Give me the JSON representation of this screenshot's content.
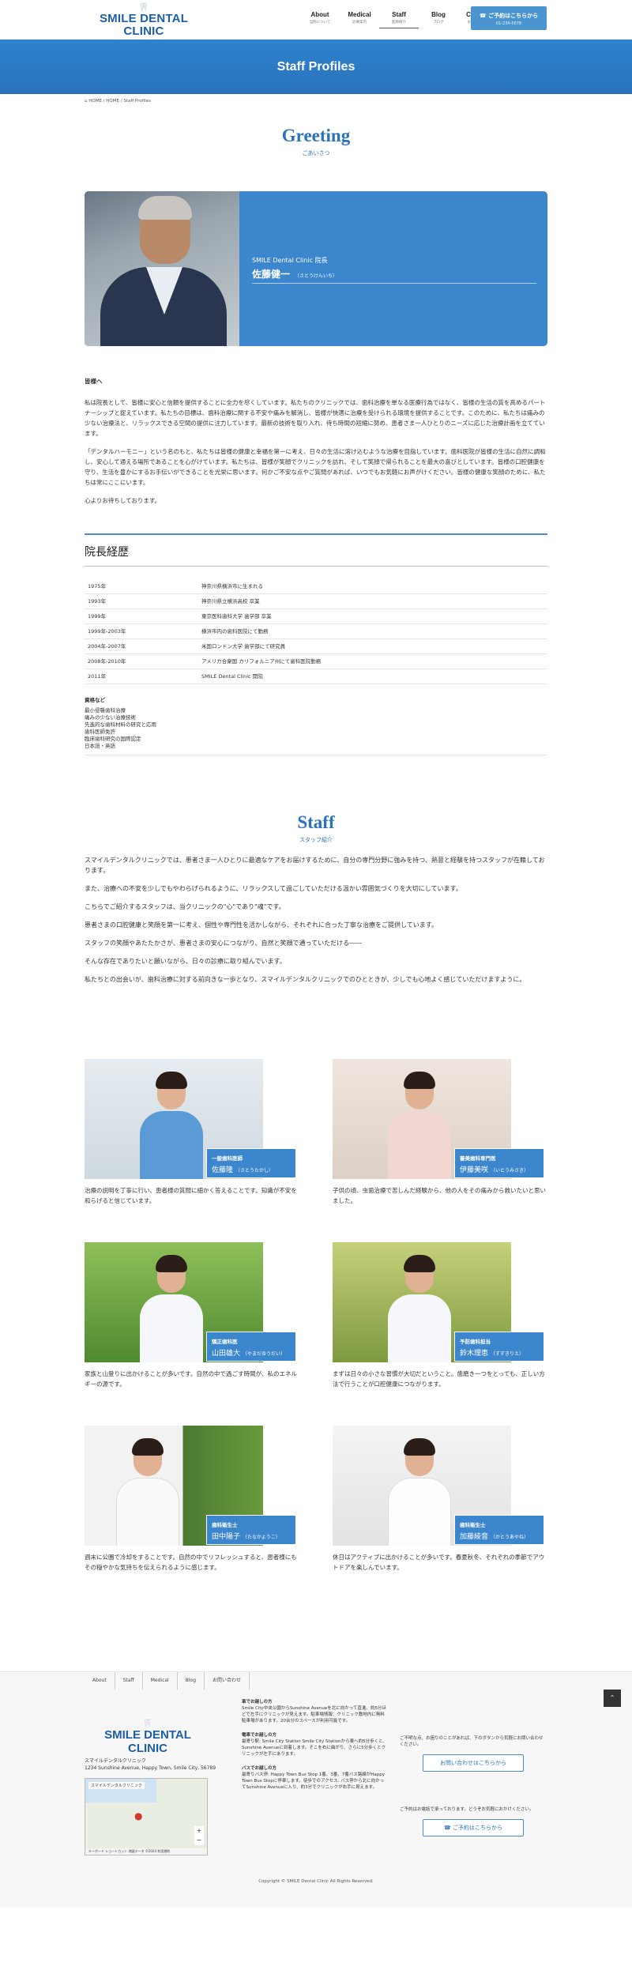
{
  "header": {
    "logo_text": "SMILE DENTAL CLINIC",
    "nav": [
      {
        "en": "About",
        "jp": "当院について"
      },
      {
        "en": "Medical",
        "jp": "診療案内"
      },
      {
        "en": "Staff",
        "jp": "医師紹介"
      },
      {
        "en": "Blog",
        "jp": "ブログ"
      },
      {
        "en": "Contact",
        "jp": "お問い合わせ"
      }
    ],
    "reserve_label": "ご予約はこちらから",
    "reserve_phone": "01-234-5678"
  },
  "banner_title": "Staff Profiles",
  "breadcrumb": "HOME  /  HOME  /  Staff Profiles",
  "greeting": {
    "title_en": "Greeting",
    "title_jp": "ごあいさつ",
    "director_role": "SMILE Dental Clinic 院長",
    "director_name": "佐藤健一",
    "director_kana": "（さとうけんいち）",
    "lead": "皆様へ",
    "paragraphs": [
      "私は院長として、皆様に安心と信頼を提供することに全力を尽くしています。私たちのクリニックでは、歯科治療を単なる医療行為ではなく、皆様の生活の質を高めるパートナーシップと捉えています。私たちの目標は、歯科治療に関する不安や痛みを解消し、皆様が快適に治療を受けられる環境を提供することです。このために、私たちは痛みの少ない治療法と、リラックスできる空間の提供に注力しています。最新の技術を取り入れ、待ち時間の短縮に努め、患者さま一人ひとりのニーズに応じた治療計画を立てています。",
      "「デンタルハーモニー」という名のもと、私たちは皆様の健康と幸福を第一に考え、日々の生活に溶け込むような治療を目指しています。歯科医院が皆様の生活に自然に調和し、安心して通える場所であることを心がけています。私たちは、皆様が笑顔でクリニックを訪れ、そして笑顔で帰られることを最大の喜びとしています。皆様の口腔健康を守り、生活を豊かにするお手伝いができることを光栄に思います。何かご不安な点やご質問があれば、いつでもお気軽にお声がけください。皆様の健康な笑顔のために、私たちは常にここにいます。",
      "心よりお待ちしております。"
    ]
  },
  "career": {
    "title": "院長経歴",
    "rows": [
      {
        "year": "1975年",
        "text": "神奈川県横浜市に生まれる"
      },
      {
        "year": "1993年",
        "text": "神奈川県立横浜高校 卒業"
      },
      {
        "year": "1999年",
        "text": "東京医科歯科大学 歯学部 卒業"
      },
      {
        "year": "1999年-2003年",
        "text": "横浜市内の歯科医院にて勤務"
      },
      {
        "year": "2004年-2007年",
        "text": "米国ロンドン大学 歯学部にて研究員"
      },
      {
        "year": "2008年-2010年",
        "text": "アメリカ合衆国 カリフォルニア州にて歯科医院勤務"
      },
      {
        "year": "2011年",
        "text": "SMILE Dental Clinic 開院"
      }
    ],
    "qual_heading": "資格など",
    "quals": [
      "最小侵襲歯科治療",
      "痛みの少ない治療技術",
      "先進的な歯科材料の研究と応用",
      "歯科医師免許",
      "臨床歯科研究の国際認定",
      "日本語・英語"
    ]
  },
  "staff": {
    "title_en": "Staff",
    "title_jp": "スタッフ紹介",
    "intro": [
      "スマイルデンタルクリニックでは、患者さま一人ひとりに最適なケアをお届けするために、自分の専門分野に強みを持つ、熱意と経験を持つスタッフが在籍しております。",
      "また、治療への不安を少しでもやわらげられるように、リラックスして過ごしていただける温かい雰囲気づくりを大切にしています。",
      "こちらでご紹介するスタッフは、当クリニックの\"心\"であり\"魂\"です。",
      "患者さまの口腔健康と笑顔を第一に考え、個性や専門性を活かしながら、それぞれに合った丁寧な治療をご提供しています。",
      "スタッフの笑顔やあたたかさが、患者さまの安心につながり、自然と笑顔で通っていただける――",
      "そんな存在でありたいと願いながら、日々の診療に取り組んでいます。",
      "私たちとの出会いが、歯科治療に対する前向きな一歩となり、スマイルデンタルクリニックでのひとときが、少しでも心地よく感じていただけますように。"
    ],
    "members": [
      {
        "role": "一般歯科医師",
        "name": "佐藤隆",
        "kana": "（さとうたかし）",
        "desc": "治療の説明を丁寧に行い、患者様の質問に細かく答えることです。知識が不安を和らげると信じています。"
      },
      {
        "role": "審美歯科専門医",
        "name": "伊藤美咲",
        "kana": "（いとうみさき）",
        "desc": "子供の頃、虫歯治療で苦しんだ経験から、他の人をその痛みから救いたいと思いました。"
      },
      {
        "role": "矯正歯科医",
        "name": "山田雄大",
        "kana": "（やまだゆうだい）",
        "desc": "家族と山登りに出かけることが多いです。自然の中で過ごす時間が、私のエネルギーの源です。"
      },
      {
        "role": "予防歯科担当",
        "name": "鈴木理恵",
        "kana": "（すずきりえ）",
        "desc": "まずは日々の小さな習慣が大切だということ。歯磨き一つをとっても、正しい方法で行うことが口腔健康につながります。"
      },
      {
        "role": "歯科衛生士",
        "name": "田中陽子",
        "kana": "（たなかようこ）",
        "desc": "週末に公園で冷却をすることです。自然の中でリフレッシュすると、患者様にもその穏やかな気持ちを伝えられるように感じます。"
      },
      {
        "role": "歯科衛生士",
        "name": "加藤綾音",
        "kana": "（かとうあやね）",
        "desc": "休日はアクティブに出かけることが多いです。春夏秋冬、それぞれの季節でアウトドアを楽しんでいます。"
      }
    ]
  },
  "footer": {
    "nav": [
      "About",
      "Staff",
      "Medical",
      "Blog",
      "お問い合わせ"
    ],
    "logo_text": "SMILE DENTAL CLINIC",
    "clinic_name": "スマイルデンタルクリニック",
    "address": "1234 Sunshine Avenue, Happy Town, Smile City, 56789",
    "map_label": "スマイルデンタルクリニック",
    "map_footer": "キーボード ショートカット  地図データ ©2024  利用規約",
    "access": [
      {
        "heading": "車でお越しの方",
        "text": "Smile City中央公園からSunshine Avenueを北に向かって直進、約5分ほどで左手にクリニックが見えます。駐車場情報：クリニック敷地内に無料駐車場があります。20台分のスペースが利用可能です。"
      },
      {
        "heading": "電車でお越しの方",
        "text": "最寄り駅: Smile City Station Smile City Stationから東へ約5分歩くと、Sunshine Avenueに到着します。そこを右に曲がり、さらに5分歩くとクリニックが左手にあります。"
      },
      {
        "heading": "バスでお越しの方",
        "text": "最寄りバス停: Happy Town Bus Stop 1番、3番、7番バス路線がHappy Town Bus Stopに停車します。徒歩でのアクセス: バス停から北に向かってSunshine Avenueに入り、約3分でクリニックが右手に見えます。"
      }
    ],
    "contact_note": "ご不明な点、お困りのことがあれば、下のボタンから気軽にお問い合わせください。",
    "contact_button": "お問い合わせはこちらから",
    "reserve_note": "ご予約はお電話で承っております。どうぞお気軽におかけください。",
    "reserve_button": "ご予約はこちらから",
    "copyright": "Copyright © SMILE Dental Clinic All Rights Reserved."
  }
}
